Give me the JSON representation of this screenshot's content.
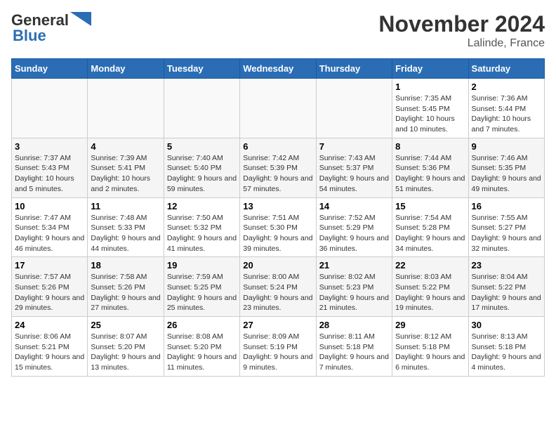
{
  "header": {
    "logo_main": "General",
    "logo_sub": "Blue",
    "month_title": "November 2024",
    "location": "Lalinde, France"
  },
  "days_of_week": [
    "Sunday",
    "Monday",
    "Tuesday",
    "Wednesday",
    "Thursday",
    "Friday",
    "Saturday"
  ],
  "weeks": [
    [
      {
        "day": null,
        "info": ""
      },
      {
        "day": null,
        "info": ""
      },
      {
        "day": null,
        "info": ""
      },
      {
        "day": null,
        "info": ""
      },
      {
        "day": null,
        "info": ""
      },
      {
        "day": "1",
        "info": "Sunrise: 7:35 AM\nSunset: 5:45 PM\nDaylight: 10 hours and 10 minutes."
      },
      {
        "day": "2",
        "info": "Sunrise: 7:36 AM\nSunset: 5:44 PM\nDaylight: 10 hours and 7 minutes."
      }
    ],
    [
      {
        "day": "3",
        "info": "Sunrise: 7:37 AM\nSunset: 5:43 PM\nDaylight: 10 hours and 5 minutes."
      },
      {
        "day": "4",
        "info": "Sunrise: 7:39 AM\nSunset: 5:41 PM\nDaylight: 10 hours and 2 minutes."
      },
      {
        "day": "5",
        "info": "Sunrise: 7:40 AM\nSunset: 5:40 PM\nDaylight: 9 hours and 59 minutes."
      },
      {
        "day": "6",
        "info": "Sunrise: 7:42 AM\nSunset: 5:39 PM\nDaylight: 9 hours and 57 minutes."
      },
      {
        "day": "7",
        "info": "Sunrise: 7:43 AM\nSunset: 5:37 PM\nDaylight: 9 hours and 54 minutes."
      },
      {
        "day": "8",
        "info": "Sunrise: 7:44 AM\nSunset: 5:36 PM\nDaylight: 9 hours and 51 minutes."
      },
      {
        "day": "9",
        "info": "Sunrise: 7:46 AM\nSunset: 5:35 PM\nDaylight: 9 hours and 49 minutes."
      }
    ],
    [
      {
        "day": "10",
        "info": "Sunrise: 7:47 AM\nSunset: 5:34 PM\nDaylight: 9 hours and 46 minutes."
      },
      {
        "day": "11",
        "info": "Sunrise: 7:48 AM\nSunset: 5:33 PM\nDaylight: 9 hours and 44 minutes."
      },
      {
        "day": "12",
        "info": "Sunrise: 7:50 AM\nSunset: 5:32 PM\nDaylight: 9 hours and 41 minutes."
      },
      {
        "day": "13",
        "info": "Sunrise: 7:51 AM\nSunset: 5:30 PM\nDaylight: 9 hours and 39 minutes."
      },
      {
        "day": "14",
        "info": "Sunrise: 7:52 AM\nSunset: 5:29 PM\nDaylight: 9 hours and 36 minutes."
      },
      {
        "day": "15",
        "info": "Sunrise: 7:54 AM\nSunset: 5:28 PM\nDaylight: 9 hours and 34 minutes."
      },
      {
        "day": "16",
        "info": "Sunrise: 7:55 AM\nSunset: 5:27 PM\nDaylight: 9 hours and 32 minutes."
      }
    ],
    [
      {
        "day": "17",
        "info": "Sunrise: 7:57 AM\nSunset: 5:26 PM\nDaylight: 9 hours and 29 minutes."
      },
      {
        "day": "18",
        "info": "Sunrise: 7:58 AM\nSunset: 5:26 PM\nDaylight: 9 hours and 27 minutes."
      },
      {
        "day": "19",
        "info": "Sunrise: 7:59 AM\nSunset: 5:25 PM\nDaylight: 9 hours and 25 minutes."
      },
      {
        "day": "20",
        "info": "Sunrise: 8:00 AM\nSunset: 5:24 PM\nDaylight: 9 hours and 23 minutes."
      },
      {
        "day": "21",
        "info": "Sunrise: 8:02 AM\nSunset: 5:23 PM\nDaylight: 9 hours and 21 minutes."
      },
      {
        "day": "22",
        "info": "Sunrise: 8:03 AM\nSunset: 5:22 PM\nDaylight: 9 hours and 19 minutes."
      },
      {
        "day": "23",
        "info": "Sunrise: 8:04 AM\nSunset: 5:22 PM\nDaylight: 9 hours and 17 minutes."
      }
    ],
    [
      {
        "day": "24",
        "info": "Sunrise: 8:06 AM\nSunset: 5:21 PM\nDaylight: 9 hours and 15 minutes."
      },
      {
        "day": "25",
        "info": "Sunrise: 8:07 AM\nSunset: 5:20 PM\nDaylight: 9 hours and 13 minutes."
      },
      {
        "day": "26",
        "info": "Sunrise: 8:08 AM\nSunset: 5:20 PM\nDaylight: 9 hours and 11 minutes."
      },
      {
        "day": "27",
        "info": "Sunrise: 8:09 AM\nSunset: 5:19 PM\nDaylight: 9 hours and 9 minutes."
      },
      {
        "day": "28",
        "info": "Sunrise: 8:11 AM\nSunset: 5:18 PM\nDaylight: 9 hours and 7 minutes."
      },
      {
        "day": "29",
        "info": "Sunrise: 8:12 AM\nSunset: 5:18 PM\nDaylight: 9 hours and 6 minutes."
      },
      {
        "day": "30",
        "info": "Sunrise: 8:13 AM\nSunset: 5:18 PM\nDaylight: 9 hours and 4 minutes."
      }
    ]
  ]
}
